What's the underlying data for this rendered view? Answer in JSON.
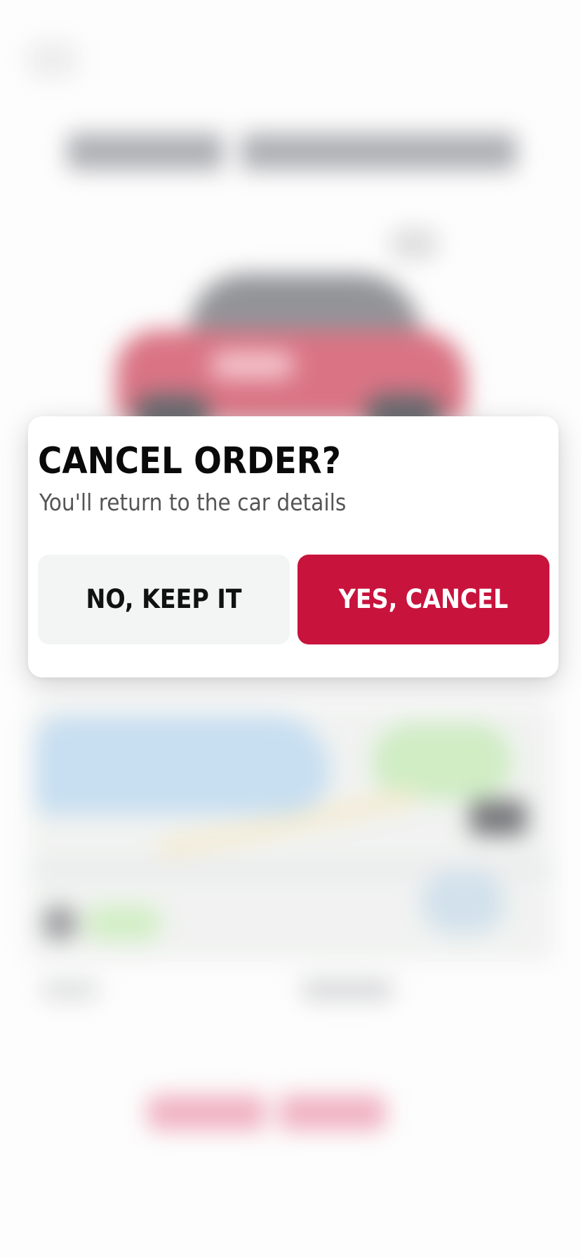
{
  "dialog": {
    "title": "CANCEL ORDER?",
    "subtitle": "You'll return to the car details",
    "keep_button_label": "NO, KEEP IT",
    "confirm_button_label": "YES, CANCEL"
  },
  "colors": {
    "accent": "#c8133d",
    "secondary_button_bg": "#f3f5f5",
    "title_text": "#0a0a0a",
    "subtitle_text": "#555555"
  }
}
